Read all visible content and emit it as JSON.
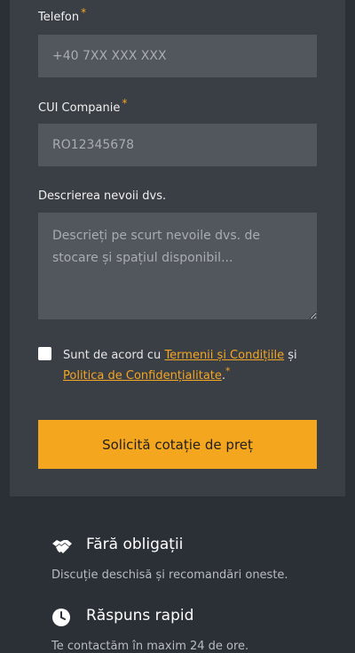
{
  "form": {
    "phone": {
      "label": "Telefon",
      "required_mark": "*",
      "placeholder": "+40 7XX XXX XXX"
    },
    "cui": {
      "label": "CUI Companie",
      "required_mark": "*",
      "placeholder": "RO12345678"
    },
    "description": {
      "label": "Descrierea nevoii dvs.",
      "placeholder": "Descrieți pe scurt nevoile dvs. de stocare și spațiul disponibil..."
    },
    "consent": {
      "prefix": "Sunt de acord cu ",
      "terms_link": "Termenii și Condițiile",
      "conjunction": " și ",
      "privacy_link": "Politica de Confidențialitate",
      "suffix": ".",
      "required_mark": "*",
      "checked": false
    },
    "submit_label": "Solicită cotație de preț"
  },
  "features": [
    {
      "icon": "handshake-icon",
      "title": "Fără obligații",
      "description": "Discuție deschisă și recomandări oneste."
    },
    {
      "icon": "clock-icon",
      "title": "Răspuns rapid",
      "description": "Te contactăm în maxim 24 de ore."
    }
  ],
  "colors": {
    "accent": "#f5a623",
    "card": "#3a3e45",
    "field": "#52565d",
    "page": "#2b2f36"
  }
}
